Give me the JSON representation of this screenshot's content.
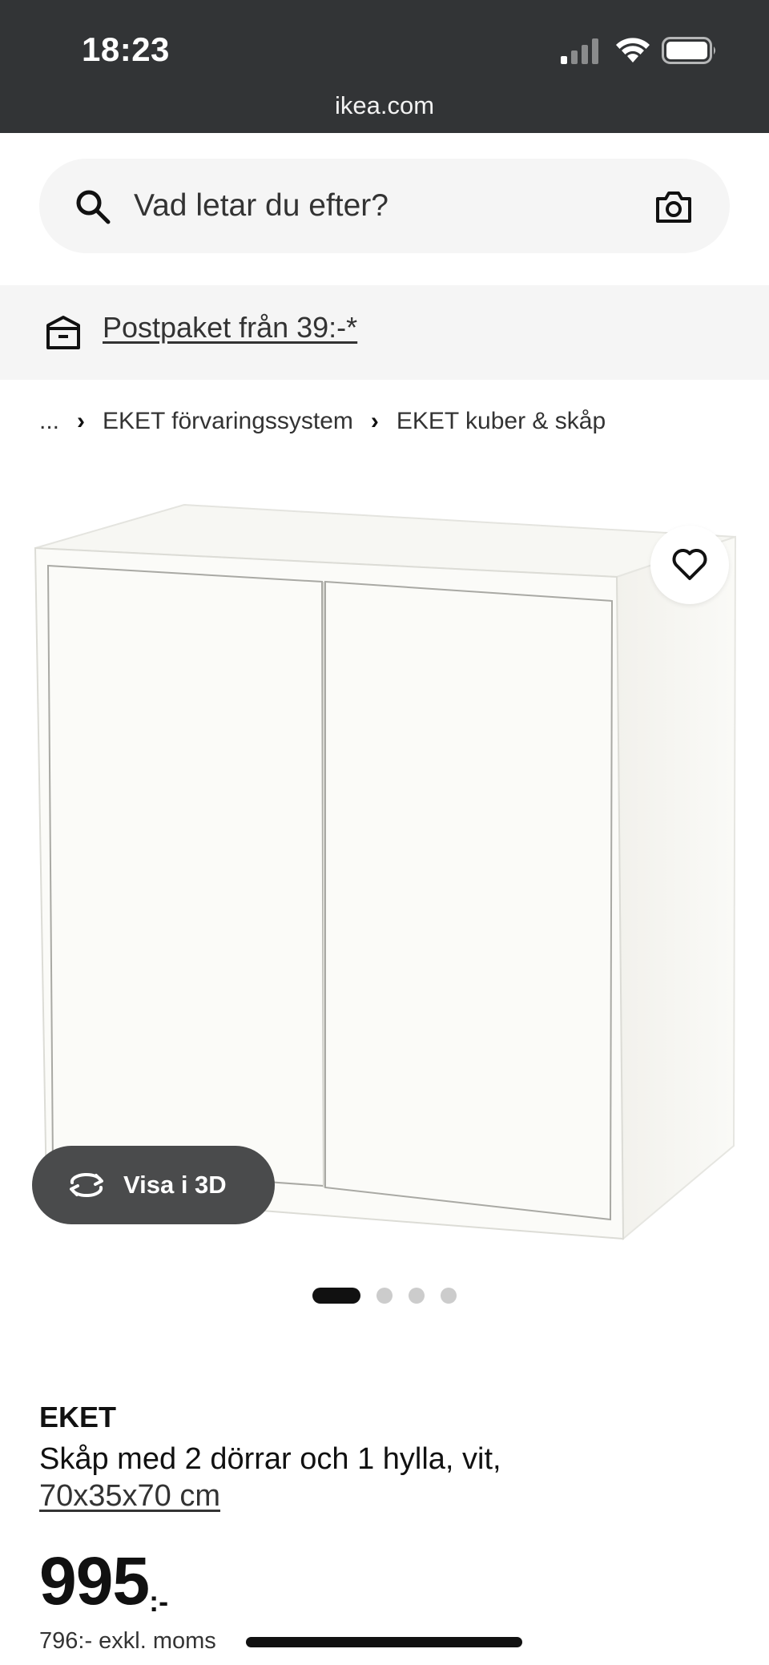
{
  "status_bar": {
    "time": "18:23",
    "url": "ikea.com",
    "icons": [
      "signal-icon",
      "wifi-icon",
      "battery-icon"
    ]
  },
  "search": {
    "placeholder": "Vad letar du efter?",
    "icon": "search-icon",
    "camera_icon": "camera-icon"
  },
  "promo": {
    "icon": "package-icon",
    "link_text": "Postpaket från 39:-*"
  },
  "breadcrumb": {
    "ellipsis": "...",
    "items": [
      "EKET förvaringssystem",
      "EKET kuber & skåp"
    ],
    "separator": "›"
  },
  "gallery": {
    "favorite_icon": "heart-icon",
    "view_3d_label": "Visa i 3D",
    "view_3d_icon": "rotate-3d-icon",
    "image_count": 4,
    "active_index": 0
  },
  "product": {
    "brand": "EKET",
    "description": "Skåp med 2 dörrar och 1 hylla, vit,",
    "size": "70x35x70 cm",
    "price": "995",
    "price_suffix": ":-",
    "price_excl_vat": "796:- exkl. moms"
  },
  "colors": {
    "status_bar_bg": "#323436",
    "surface_gray": "#f5f5f5",
    "text_primary": "#111111",
    "pill_dark": "#4a4b4c"
  }
}
